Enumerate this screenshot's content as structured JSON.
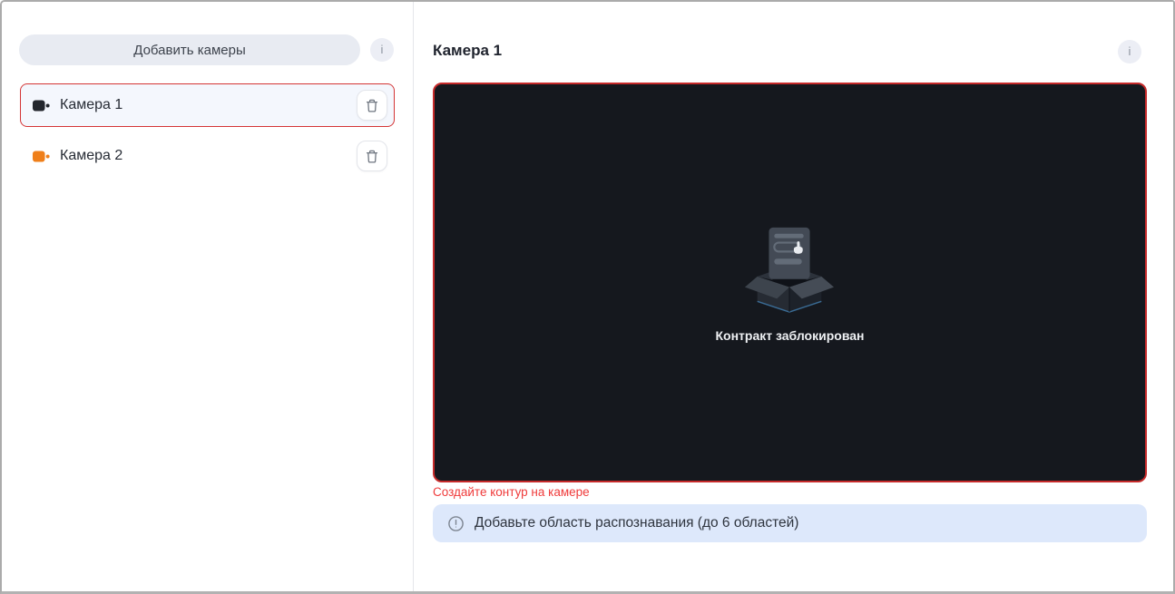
{
  "sidebar": {
    "add_button": {
      "label": "Добавить камеры"
    },
    "info_button": {
      "label": "i"
    },
    "cameras": [
      {
        "name": "Камера 1",
        "selected": true
      },
      {
        "name": "Камера 2",
        "selected": false
      }
    ]
  },
  "main": {
    "title": "Камера 1",
    "info_button": {
      "label": "i"
    },
    "video": {
      "status_title": "Контракт заблокирован"
    },
    "error_text": "Создайте контур на камере",
    "banner": {
      "text": "Добавьте область распознавания (до 6 областей)"
    }
  },
  "icons": {
    "camera": "videocam",
    "delete": "trash-can",
    "info": "letter-i-circle",
    "notice": "exclamation-circle",
    "empty_state": "open-box-with-card-and-hand-cursor"
  },
  "colors": {
    "selected_row_border": "#d43535",
    "selected_row_bg": "#f4f7fd",
    "video_border": "#c62a2a",
    "video_bg": "#15181e",
    "error_text": "#ef3b3b",
    "banner_bg": "#dde8fb",
    "add_button_bg": "#e8ebf2",
    "camera1_icon": "#23262d",
    "camera2_icon": "#ef7f1a"
  }
}
